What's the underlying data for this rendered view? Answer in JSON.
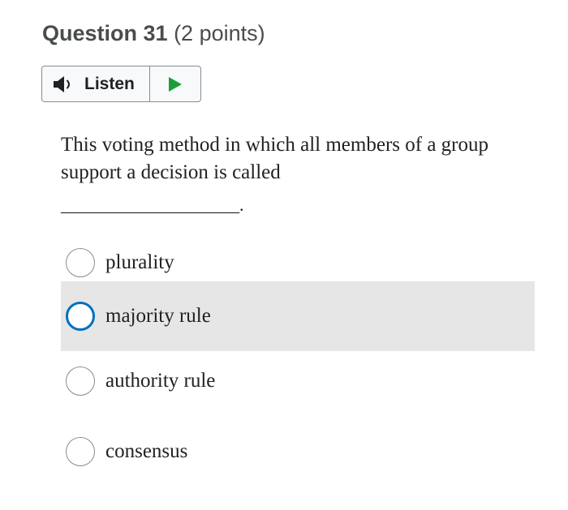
{
  "question": {
    "title": "Question 31",
    "points": "(2 points)"
  },
  "listen": {
    "label": "Listen",
    "speaker_icon": "speaker-icon",
    "play_icon": "play-icon",
    "play_color": "#1a9e3a"
  },
  "prompt": {
    "text": "This voting method in which all members of a group support a decision is called",
    "blank": "____________________."
  },
  "options": [
    {
      "label": "plurality",
      "selected": false
    },
    {
      "label": "majority rule",
      "selected": false
    },
    {
      "label": "authority rule",
      "selected": false
    },
    {
      "label": "consensus",
      "selected": false
    }
  ],
  "colors": {
    "focus_ring": "#006fbf",
    "hover_background": "#e6e6e6",
    "text": "#202122",
    "heading": "#494c4e"
  }
}
